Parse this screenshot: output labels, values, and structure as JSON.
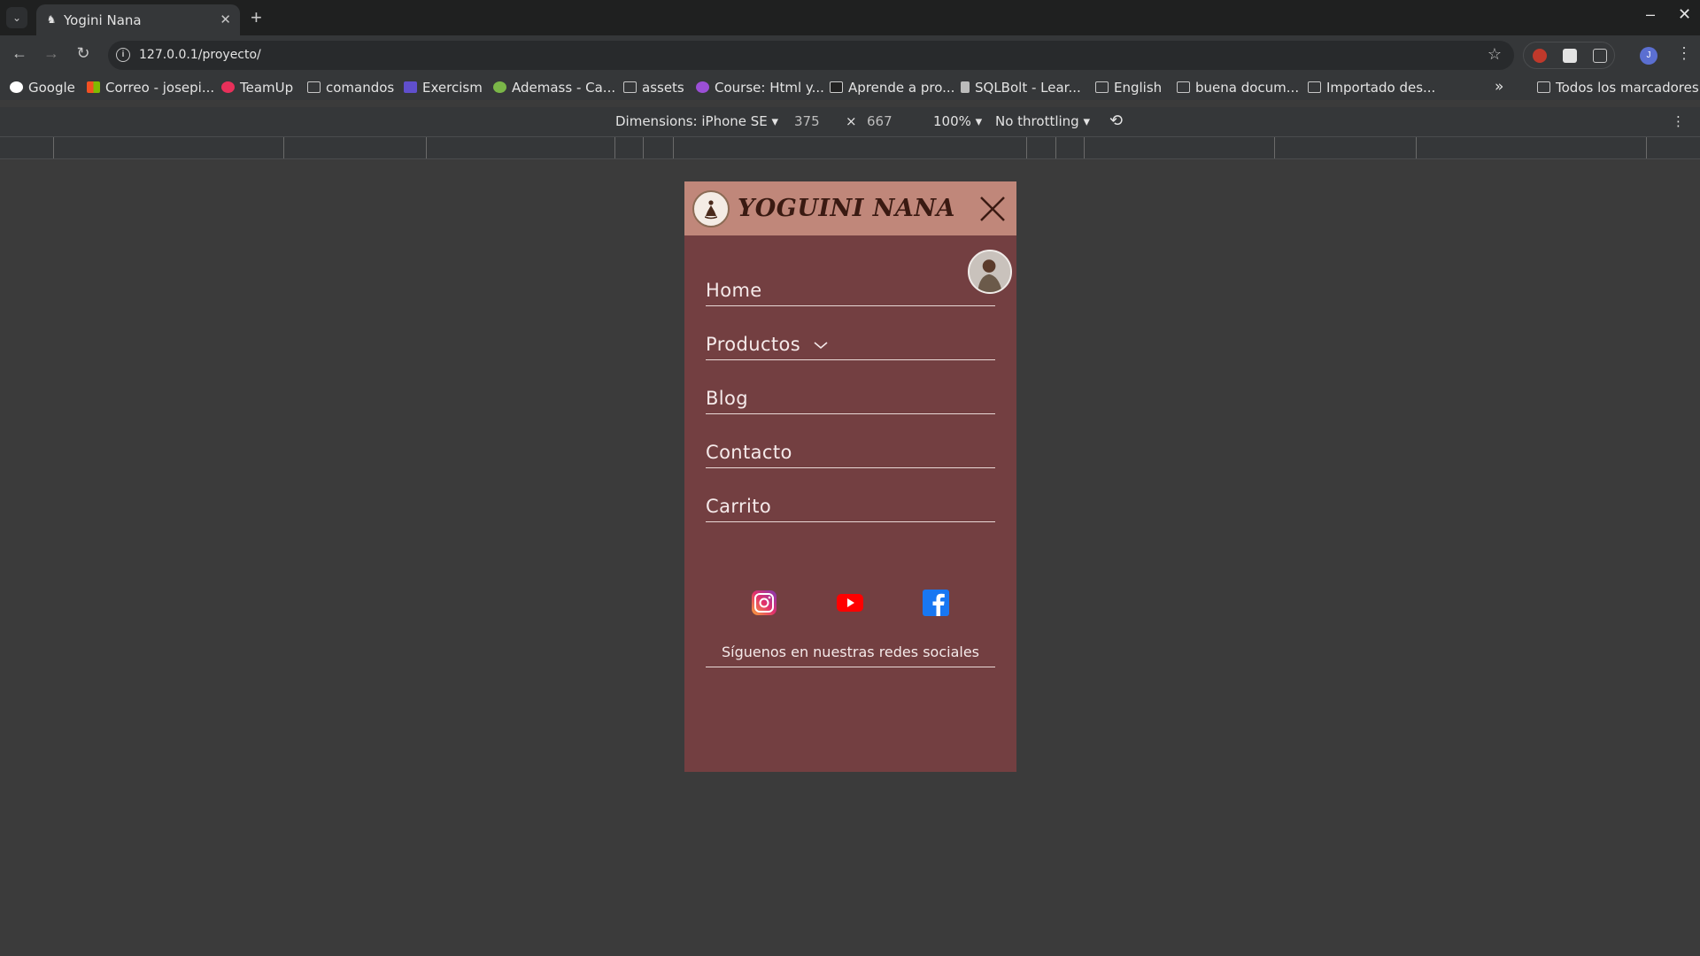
{
  "browser": {
    "tab_title": "Yogini Nana",
    "url": "127.0.0.1/proyecto/",
    "bookmarks": [
      {
        "label": "Google",
        "icon": "google-icon"
      },
      {
        "label": "Correo - josepi...",
        "icon": "microsoft-icon"
      },
      {
        "label": "TeamUp",
        "icon": "teamup-icon"
      },
      {
        "label": "comandos",
        "icon": "folder-icon"
      },
      {
        "label": "Exercism",
        "icon": "exercism-icon"
      },
      {
        "label": "Ademass - Ca...",
        "icon": "ademass-icon"
      },
      {
        "label": "assets",
        "icon": "folder-icon"
      },
      {
        "label": "Course: Html y...",
        "icon": "course-icon"
      },
      {
        "label": "Aprende a pro...",
        "icon": "aprende-icon"
      },
      {
        "label": "SQLBolt - Lear...",
        "icon": "sqlbolt-icon"
      },
      {
        "label": "English",
        "icon": "folder-icon"
      },
      {
        "label": "buena docum...",
        "icon": "folder-icon"
      },
      {
        "label": "Importado des...",
        "icon": "folder-icon"
      }
    ],
    "bookmarks_overflow": "»",
    "all_bookmarks": "Todos los marcadores",
    "profile_initial": "J"
  },
  "devtools": {
    "dimensions_label": "Dimensions: iPhone SE ▾",
    "width": "375",
    "times": "×",
    "height": "667",
    "zoom": "100% ▾",
    "throttling": "No throttling ▾"
  },
  "site": {
    "brand": "YOGUINI NANA",
    "nav": [
      {
        "label": "Home"
      },
      {
        "label": "Productos",
        "has_dropdown": true
      },
      {
        "label": "Blog"
      },
      {
        "label": "Contacto"
      },
      {
        "label": "Carrito"
      }
    ],
    "follow_text": "Síguenos en nuestras redes sociales",
    "colors": {
      "header_bg": "#c0877a",
      "menu_bg": "#733f41",
      "brand_text": "#3a1a12",
      "nav_text": "#f5eaea"
    }
  }
}
